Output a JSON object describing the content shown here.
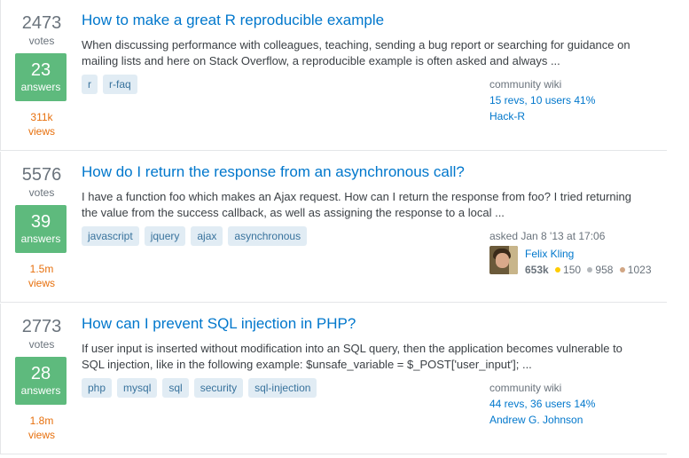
{
  "questions": [
    {
      "votes": "2473",
      "votes_label": "votes",
      "answers": "23",
      "answers_label": "answers",
      "views": "311k",
      "views_label": "views",
      "title": "How to make a great R reproducible example",
      "excerpt": "When discussing performance with colleagues, teaching, sending a bug report or searching for guidance on mailing lists and here on Stack Overflow, a reproducible example is often asked and always ...",
      "tags": [
        "r",
        "r-faq"
      ],
      "owner": {
        "type_label": "community wiki",
        "revs": "15 revs, 10 users 41%",
        "user": "Hack-R"
      }
    },
    {
      "votes": "5576",
      "votes_label": "votes",
      "answers": "39",
      "answers_label": "answers",
      "views": "1.5m",
      "views_label": "views",
      "title": "How do I return the response from an asynchronous call?",
      "excerpt": "I have a function foo which makes an Ajax request. How can I return the response from foo? I tried returning the value from the success callback, as well as assigning the response to a local ...",
      "tags": [
        "javascript",
        "jquery",
        "ajax",
        "asynchronous"
      ],
      "owner": {
        "asked": "asked Jan 8 '13 at 17:06",
        "user": "Felix Kling",
        "reputation": "653k",
        "gold": "150",
        "silver": "958",
        "bronze": "1023"
      }
    },
    {
      "votes": "2773",
      "votes_label": "votes",
      "answers": "28",
      "answers_label": "answers",
      "views": "1.8m",
      "views_label": "views",
      "title": "How can I prevent SQL injection in PHP?",
      "excerpt": "If user input is inserted without modification into an SQL query, then the application becomes vulnerable to SQL injection, like in the following example: $unsafe_variable = $_POST['user_input']; ...",
      "tags": [
        "php",
        "mysql",
        "sql",
        "security",
        "sql-injection"
      ],
      "owner": {
        "type_label": "community wiki",
        "revs": "44 revs, 36 users 14%",
        "user": "Andrew G. Johnson"
      }
    }
  ],
  "colors": {
    "link": "#0077cc",
    "accepted_answers_bg": "#5eba7d",
    "views": "#e7700d",
    "tag_bg": "#e1ecf4",
    "tag_text": "#39739d"
  }
}
